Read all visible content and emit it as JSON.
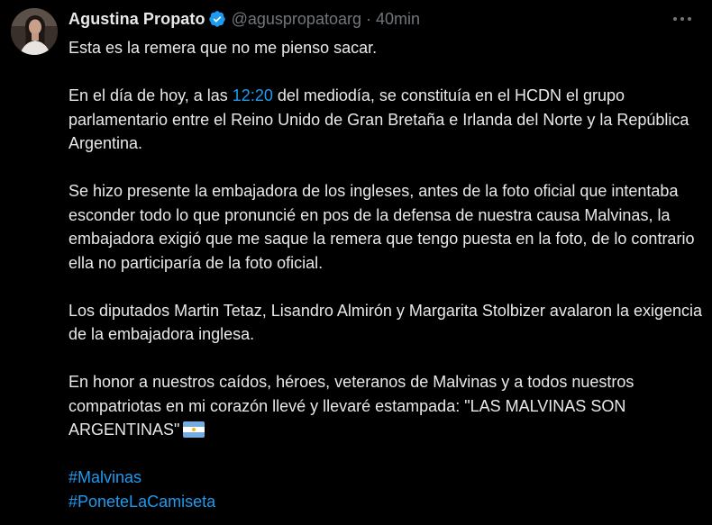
{
  "author": {
    "name": "Agustina Propato",
    "handle": "@aguspropatoarg",
    "separator": "·",
    "time": "40min"
  },
  "icons": {
    "avatar": "profile-photo",
    "verified": "verified-badge-icon",
    "more": "more-options-icon",
    "flag": "argentina-flag-emoji"
  },
  "colors": {
    "background": "#000000",
    "text": "#e7e9ea",
    "secondary": "#71767b",
    "accent": "#1d9bf0"
  },
  "tweet": {
    "p1": "Esta es la remera que no me pienso sacar.",
    "p2_pre": "En el día de hoy, a las ",
    "p2_time": "12:20",
    "p2_post": " del mediodía, se constituía en el HCDN el grupo parlamentario entre el Reino Unido de Gran Bretaña e Irlanda del Norte y la República Argentina.",
    "p3": "Se hizo presente la embajadora de los ingleses, antes de la foto oficial que intentaba esconder todo lo que pronuncié en pos de la defensa de nuestra causa Malvinas, la embajadora exigió que me saque la remera que tengo puesta en la foto, de lo contrario ella no participaría de la foto oficial.",
    "p4": "Los diputados Martin Tetaz, Lisandro Almirón y Margarita Stolbizer avalaron la exigencia de la embajadora inglesa.",
    "p5": "En honor a nuestros caídos, héroes, veteranos de Malvinas y a todos nuestros compatriotas en mi corazón llevé y llevaré estampada: \"LAS MALVINAS SON ARGENTINAS\"",
    "hashtags": [
      "#Malvinas",
      "#PoneteLaCamiseta"
    ]
  }
}
